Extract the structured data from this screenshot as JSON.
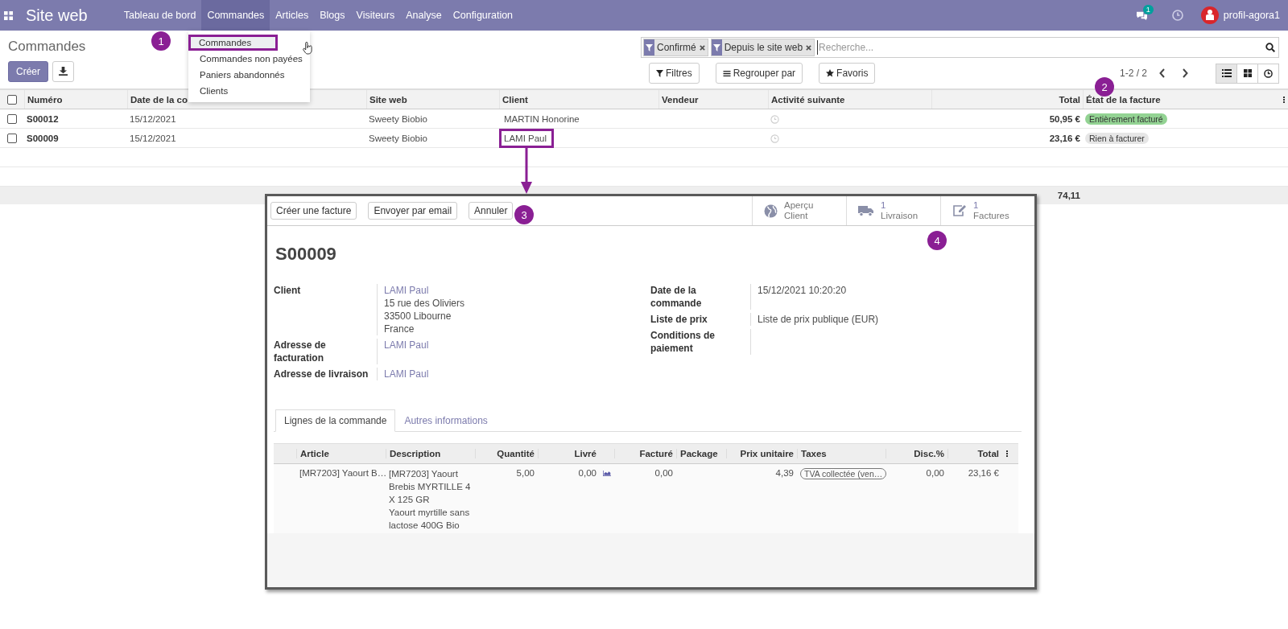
{
  "navbar": {
    "app_title": "Site web",
    "menu": [
      {
        "label": "Tableau de bord",
        "selected": false
      },
      {
        "label": "Commandes",
        "selected": true
      },
      {
        "label": "Articles",
        "selected": false
      },
      {
        "label": "Blogs",
        "selected": false
      },
      {
        "label": "Visiteurs",
        "selected": false
      },
      {
        "label": "Analyse",
        "selected": false
      },
      {
        "label": "Configuration",
        "selected": false
      }
    ],
    "chat_badge": "1",
    "user": "profil-agora1"
  },
  "dropdown": [
    {
      "label": "Commandes",
      "highlighted": true
    },
    {
      "label": "Commandes non payées",
      "highlighted": false
    },
    {
      "label": "Paniers abandonnés",
      "highlighted": false
    },
    {
      "label": "Clients",
      "highlighted": false
    }
  ],
  "control_panel": {
    "breadcrumb": "Commandes",
    "create_button": "Créer",
    "facets": [
      {
        "label": "Confirmé"
      },
      {
        "label": "Depuis le site web"
      }
    ],
    "search": {
      "placeholder": "Recherche..."
    },
    "filter_buttons": [
      {
        "kind": "filter",
        "label": "Filtres"
      },
      {
        "kind": "group",
        "label": "Regrouper par"
      },
      {
        "kind": "star",
        "label": "Favoris"
      }
    ],
    "pager": "1-2 / 2",
    "views": [
      {
        "kind": "list",
        "selected": true
      },
      {
        "kind": "kanban",
        "selected": false
      },
      {
        "kind": "activity",
        "selected": false
      }
    ]
  },
  "table": {
    "all_checked": false,
    "columns": [
      "Numéro",
      "Date de la co",
      "Site web",
      "Client",
      "Vendeur",
      "Activité suivante",
      "Total",
      "État de la facture"
    ],
    "rows": [
      {
        "checked": false,
        "number": "S00012",
        "date": "15/12/2021",
        "website": "Sweety Biobio",
        "client": "MARTIN Honorine",
        "client_highlighted": false,
        "total": "50,95 €",
        "status": {
          "label": "Entièrement facturé",
          "color": "#93d393"
        }
      },
      {
        "checked": false,
        "number": "S00009",
        "date": "15/12/2021",
        "website": "Sweety Biobio",
        "client": "LAMI Paul",
        "client_highlighted": true,
        "total": "23,16 €",
        "status": {
          "label": "Rien à facturer",
          "color": "#e6e6e6"
        }
      }
    ],
    "footer_total": "74,11"
  },
  "detail": {
    "buttons": [
      "Créer une facture",
      "Envoyer par email",
      "Annuler"
    ],
    "smart_buttons": [
      {
        "kind": "globe",
        "lines": [
          "Aperçu",
          "Client"
        ]
      },
      {
        "kind": "truck",
        "lines": [
          "1",
          "Livraison"
        ]
      },
      {
        "kind": "edit",
        "lines": [
          "1",
          "Factures"
        ]
      }
    ],
    "title": "S00009",
    "left_fields": [
      {
        "label": "Client",
        "values": [
          "LAMI Paul",
          "15 rue des Oliviers",
          "33500 Libourne",
          "France"
        ]
      },
      {
        "label": "Adresse de facturation",
        "values": [
          "LAMI Paul"
        ]
      },
      {
        "label": "Adresse de livraison",
        "values": [
          "LAMI Paul"
        ]
      }
    ],
    "right_fields": [
      {
        "label": "Date de la commande",
        "values": [
          "15/12/2021 10:20:20"
        ]
      },
      {
        "label": "Liste de prix",
        "values": [
          "Liste de prix publique (EUR)"
        ]
      },
      {
        "label": "Conditions de paiement"
      }
    ],
    "tabs": [
      {
        "label": "Lignes de la commande",
        "selected": true
      },
      {
        "label": "Autres informations",
        "selected": false
      }
    ],
    "lines_columns": [
      "Article",
      "Description",
      "Quantité",
      "Livré",
      "Facturé",
      "Package",
      "Prix unitaire",
      "Taxes",
      "Disc.%",
      "Total"
    ],
    "lines": [
      {
        "article": "[MR7203] Yaourt B…",
        "description": [
          "[MR7203] Yaourt Brebis MYRTILLE 4 X 125 GR",
          "Yaourt myrtille sans lactose 400G Bio"
        ],
        "quantity": "5,00",
        "delivered": "0,00",
        "invoiced": "0,00",
        "unit_price": "4,39",
        "tax": "TVA collectée (ven…",
        "discount": "0,00",
        "total": "23,16 €"
      }
    ]
  },
  "annotations": [
    {
      "label": "1"
    },
    {
      "label": "2"
    },
    {
      "label": "3"
    },
    {
      "label": "4"
    }
  ]
}
